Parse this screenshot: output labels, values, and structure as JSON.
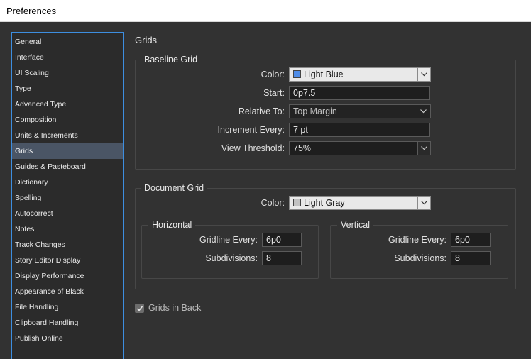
{
  "window": {
    "title": "Preferences"
  },
  "sidebar": {
    "items": [
      "General",
      "Interface",
      "UI Scaling",
      "Type",
      "Advanced Type",
      "Composition",
      "Units & Increments",
      "Grids",
      "Guides & Pasteboard",
      "Dictionary",
      "Spelling",
      "Autocorrect",
      "Notes",
      "Track Changes",
      "Story Editor Display",
      "Display Performance",
      "Appearance of Black",
      "File Handling",
      "Clipboard Handling",
      "Publish Online"
    ],
    "selected": "Grids"
  },
  "panel": {
    "title": "Grids"
  },
  "baseline_grid": {
    "title": "Baseline Grid",
    "color_label": "Color:",
    "color_value": "Light Blue",
    "color_swatch": "#4f8de9",
    "start_label": "Start:",
    "start_value": "0p7.5",
    "relative_label": "Relative To:",
    "relative_value": "Top Margin",
    "increment_label": "Increment Every:",
    "increment_value": "7 pt",
    "threshold_label": "View Threshold:",
    "threshold_value": "75%"
  },
  "document_grid": {
    "title": "Document Grid",
    "color_label": "Color:",
    "color_value": "Light Gray",
    "color_swatch": "#c2c2c2",
    "horizontal": {
      "title": "Horizontal",
      "gridline_label": "Gridline Every:",
      "gridline_value": "6p0",
      "subdivisions_label": "Subdivisions:",
      "subdivisions_value": "8"
    },
    "vertical": {
      "title": "Vertical",
      "gridline_label": "Gridline Every:",
      "gridline_value": "6p0",
      "subdivisions_label": "Subdivisions:",
      "subdivisions_value": "8"
    }
  },
  "options": {
    "grids_in_back_label": "Grids in Back",
    "grids_in_back_checked": true
  },
  "colors": {
    "accent": "#3d8ee0",
    "selected_row": "#4a5565",
    "background": "#323232"
  }
}
